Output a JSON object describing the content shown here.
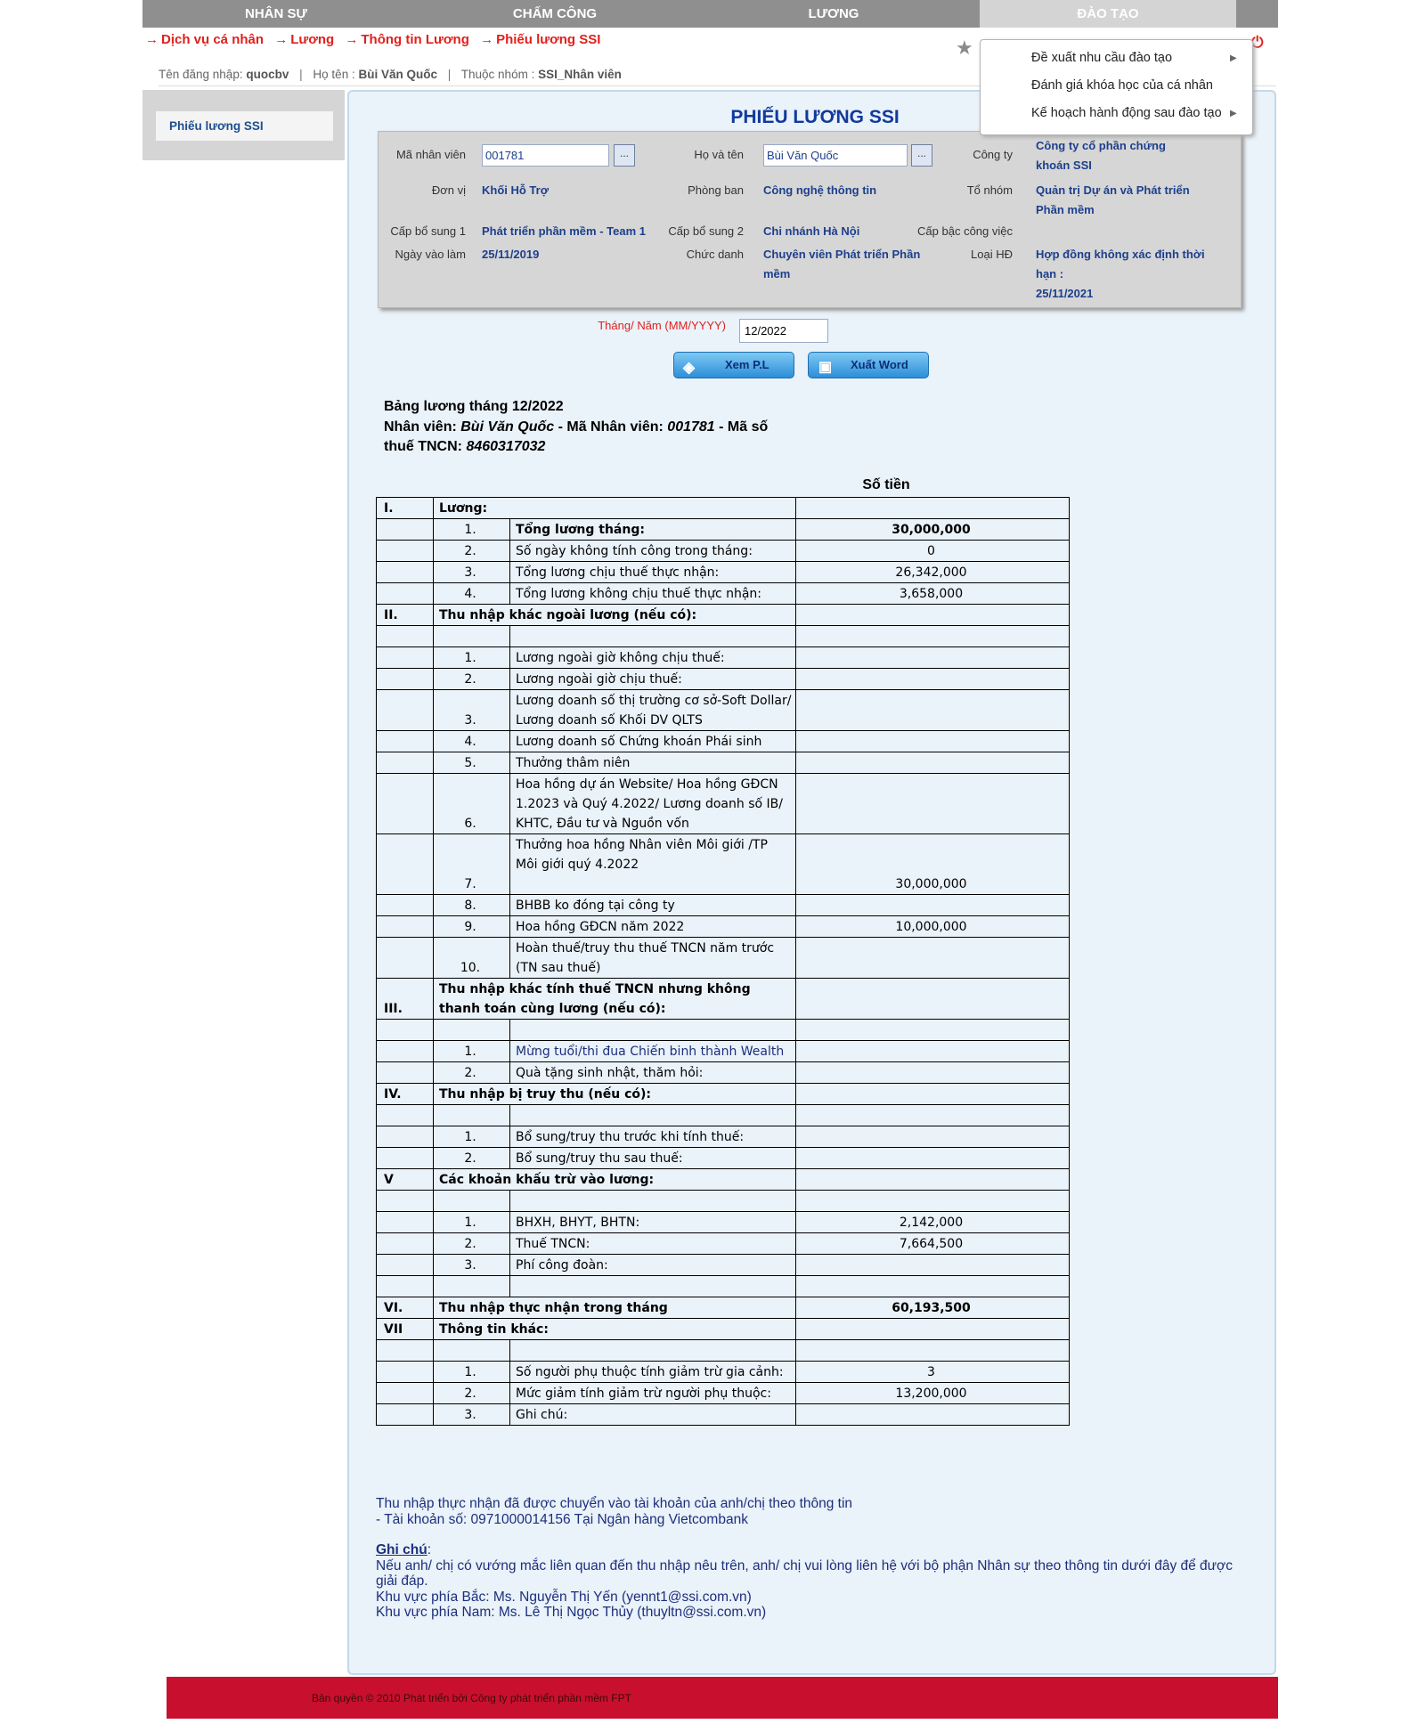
{
  "nav": {
    "items": [
      "NHÂN SỰ",
      "CHẤM CÔNG",
      "LƯƠNG",
      "ĐÀO TẠO"
    ],
    "active": "ĐÀO TẠO"
  },
  "breadcrumb": [
    "Dịch vụ cá nhân",
    "Lương",
    "Thông tin Lương",
    "Phiếu lương SSI"
  ],
  "user": {
    "login_label": "Tên đăng nhập:",
    "login": "quocbv",
    "name_label": "Họ tên :",
    "name": "Bùi Văn Quốc",
    "group_label": "Thuộc nhóm :",
    "group": "SSI_Nhân viên"
  },
  "dropdown": {
    "items": [
      "Đề xuất nhu cầu đào tạo",
      "Đánh giá khóa học của cá nhân",
      "Kế hoạch hành động sau đào tạo"
    ]
  },
  "sidebar": {
    "item": "Phiếu lương SSI"
  },
  "page_title": "PHIẾU LƯƠNG SSI",
  "info": {
    "ma_nv_label": "Mã nhân viên",
    "ma_nv": "001781",
    "ho_ten_label": "Họ và tên",
    "ho_ten": "Bùi Văn Quốc",
    "cong_ty_label": "Công ty",
    "cong_ty": "Công ty cổ phần chứng khoán SSI",
    "don_vi_label": "Đơn vị",
    "don_vi": "Khối Hỗ Trợ",
    "phong_ban_label": "Phòng ban",
    "phong_ban": "Công nghệ thông tin",
    "to_nhom_label": "Tổ nhóm",
    "to_nhom": "Quản trị Dự án và Phát triển Phần mềm",
    "cap1_label": "Cấp bổ sung 1",
    "cap1": "Phát triển phần mềm - Team 1",
    "cap2_label": "Cấp bổ sung 2",
    "cap2": "Chi nhánh Hà Nội",
    "cap_bac_label": "Cấp bậc công việc",
    "ngay_label": "Ngày vào làm",
    "ngay": "25/11/2019",
    "chuc_danh_label": "Chức danh",
    "chuc_danh": "Chuyên viên Phát triển Phần mềm",
    "loai_hd_label": "Loại HĐ",
    "loai_hd": "Hợp đồng không xác định thời hạn :",
    "loai_hd_date": "25/11/2021",
    "dots": "..."
  },
  "month": {
    "label": "Tháng/ Năm (MM/YYYY)",
    "value": "12/2022"
  },
  "buttons": {
    "view": "Xem P.L",
    "word": "Xuất Word"
  },
  "slip": {
    "line1": "Bảng lương tháng 12/2022",
    "nv_label": "Nhân viên:",
    "nv": "Bùi Văn Quốc",
    "ma_label": "- Mã Nhân viên:",
    "ma": "001781",
    "mst_label": "- Mã số thuế TNCN:",
    "mst": "8460317032",
    "so_tien": "Số tiền"
  },
  "table": {
    "sec1": {
      "num": "I.",
      "title": "Lương:"
    },
    "r1": {
      "n": "1.",
      "label": "Tổng lương tháng:",
      "v": "30,000,000"
    },
    "r2": {
      "n": "2.",
      "label": "Số ngày không tính công trong tháng:",
      "v": "0"
    },
    "r3": {
      "n": "3.",
      "label": "Tổng lương chịu thuế thực nhận:",
      "v": "26,342,000"
    },
    "r4": {
      "n": "4.",
      "label": "Tổng lương không chịu thuế thực nhận:",
      "v": "3,658,000"
    },
    "sec2": {
      "num": "II.",
      "title": "Thu nhập khác ngoài lương (nếu có):"
    },
    "s2r1": {
      "n": "1.",
      "label": "Lương ngoài giờ không chịu thuế:"
    },
    "s2r2": {
      "n": "2.",
      "label": "Lương ngoài giờ chịu thuế:"
    },
    "s2r3": {
      "n": "3.",
      "label": "Lương doanh số thị trường cơ sở-Soft Dollar/ Lương doanh số Khối DV QLTS"
    },
    "s2r4": {
      "n": "4.",
      "label": "Lương doanh số Chứng khoán Phái sinh"
    },
    "s2r5": {
      "n": "5.",
      "label": "Thưởng thâm niên"
    },
    "s2r6": {
      "n": "6.",
      "label": "Hoa hồng dự án Website/ Hoa hồng GĐCN 1.2023 và Quý 4.2022/ Lương doanh số IB/ KHTC, Đầu tư và Nguồn vốn"
    },
    "s2r7": {
      "n": "7.",
      "label": "Thưởng hoa hồng Nhân viên Môi giới /TP Môi giới quý 4.2022",
      "v": "30,000,000"
    },
    "s2r8": {
      "n": "8.",
      "label": "BHBB ko đóng tại công ty"
    },
    "s2r9": {
      "n": "9.",
      "label": "Hoa hồng GĐCN năm 2022",
      "v": "10,000,000"
    },
    "s2r10": {
      "n": "10.",
      "label": "Hoàn thuế/truy thu thuế TNCN năm trước (TN sau thuế)"
    },
    "sec3": {
      "num": "III.",
      "title": "Thu nhập khác tính thuế TNCN nhưng không thanh toán cùng lương (nếu có):"
    },
    "s3r1": {
      "n": "1.",
      "label": "Mừng tuổi/thi đua Chiến binh thành Wealth"
    },
    "s3r2": {
      "n": "2.",
      "label": "Quà tặng sinh nhật, thăm hỏi:"
    },
    "sec4": {
      "num": "IV.",
      "title": "Thu nhập bị truy thu (nếu có):"
    },
    "s4r1": {
      "n": "1.",
      "label": "Bổ sung/truy thu trước khi tính thuế:"
    },
    "s4r2": {
      "n": "2.",
      "label": "Bổ sung/truy thu sau thuế:"
    },
    "sec5": {
      "num": "V",
      "title": "Các khoản khấu trừ vào lương:"
    },
    "s5r1": {
      "n": "1.",
      "label": "BHXH, BHYT, BHTN:",
      "v": "2,142,000"
    },
    "s5r2": {
      "n": "2.",
      "label": "Thuế TNCN:",
      "v": "7,664,500"
    },
    "s5r3": {
      "n": "3.",
      "label": "Phí công đoàn:"
    },
    "sec6": {
      "num": "VI.",
      "title": "Thu nhập thực nhận trong tháng",
      "v": "60,193,500"
    },
    "sec7": {
      "num": "VII",
      "title": "Thông tin khác:"
    },
    "s7r1": {
      "n": "1.",
      "label": "Số người phụ thuộc tính giảm trừ gia cảnh:",
      "v": "3"
    },
    "s7r2": {
      "n": "2.",
      "label": "Mức giảm tính giảm trừ người phụ thuộc:",
      "v": "13,200,000"
    },
    "s7r3": {
      "n": "3.",
      "label": "Ghi chú:"
    }
  },
  "notes": {
    "l1": "Thu nhập thực nhận đã được chuyển vào tài khoản của anh/chị theo thông tin",
    "l2": "- Tài khoản số:  0971000014156 Tại Ngân hàng Vietcombank",
    "ghichu": "Ghi chú",
    "l3": "Nếu anh/ chị có vướng mắc liên quan đến thu nhập nêu trên, anh/ chị vui lòng liên hệ với bộ phận Nhân sự theo thông tin dưới đây để được giải đáp.",
    "l4": "Khu vực phía Bắc:  Ms. Nguyễn Thị Yến (yennt1@ssi.com.vn)",
    "l5": "Khu vực phía Nam:  Ms. Lê Thị Ngọc Thủy (thuyltn@ssi.com.vn)"
  },
  "copyright": "Bản quyền © 2010 Phát triển bởi Công ty phát triển phần mềm FPT"
}
